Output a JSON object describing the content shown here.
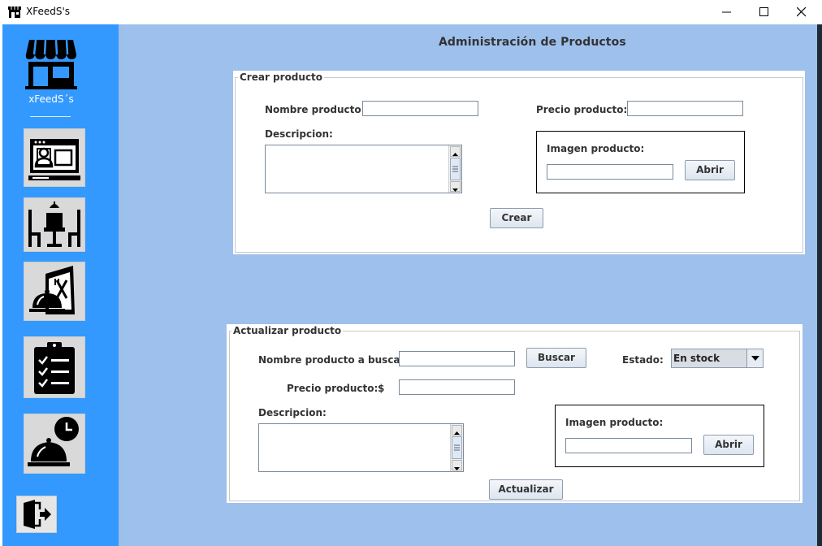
{
  "window": {
    "title": "XFeedS's"
  },
  "sidebar": {
    "brand": "xFeedS´s",
    "items": [
      {
        "name": "monitor-user-icon"
      },
      {
        "name": "dining-table-icon"
      },
      {
        "name": "menu-cloche-icon"
      },
      {
        "name": "clipboard-checklist-icon"
      },
      {
        "name": "cloche-clock-icon"
      }
    ],
    "logout_icon": "logout-icon"
  },
  "main": {
    "title": "Administración de Productos",
    "create": {
      "legend": "Crear producto",
      "name_label": "Nombre producto:",
      "name_value": "",
      "price_label": "Precio producto:",
      "price_value": "",
      "desc_label": "Descripcion:",
      "image_label": "Imagen producto:",
      "image_value": "",
      "open_label": "Abrir",
      "create_label": "Crear"
    },
    "update": {
      "legend": "Actualizar  producto",
      "search_label": "Nombre producto a buscar:",
      "search_value": "",
      "search_button": "Buscar",
      "state_label": "Estado:",
      "state_value": "En stock",
      "price_label": "Precio producto:",
      "currency": "$",
      "price_value": "",
      "desc_label": "Descripcion:",
      "image_label": "Imagen producto:",
      "image_value": "",
      "open_label": "Abrir",
      "update_label": "Actualizar"
    }
  },
  "colors": {
    "sidebar": "#3399ff",
    "main_background": "#9ec0ec",
    "panel": "#ffffff"
  }
}
